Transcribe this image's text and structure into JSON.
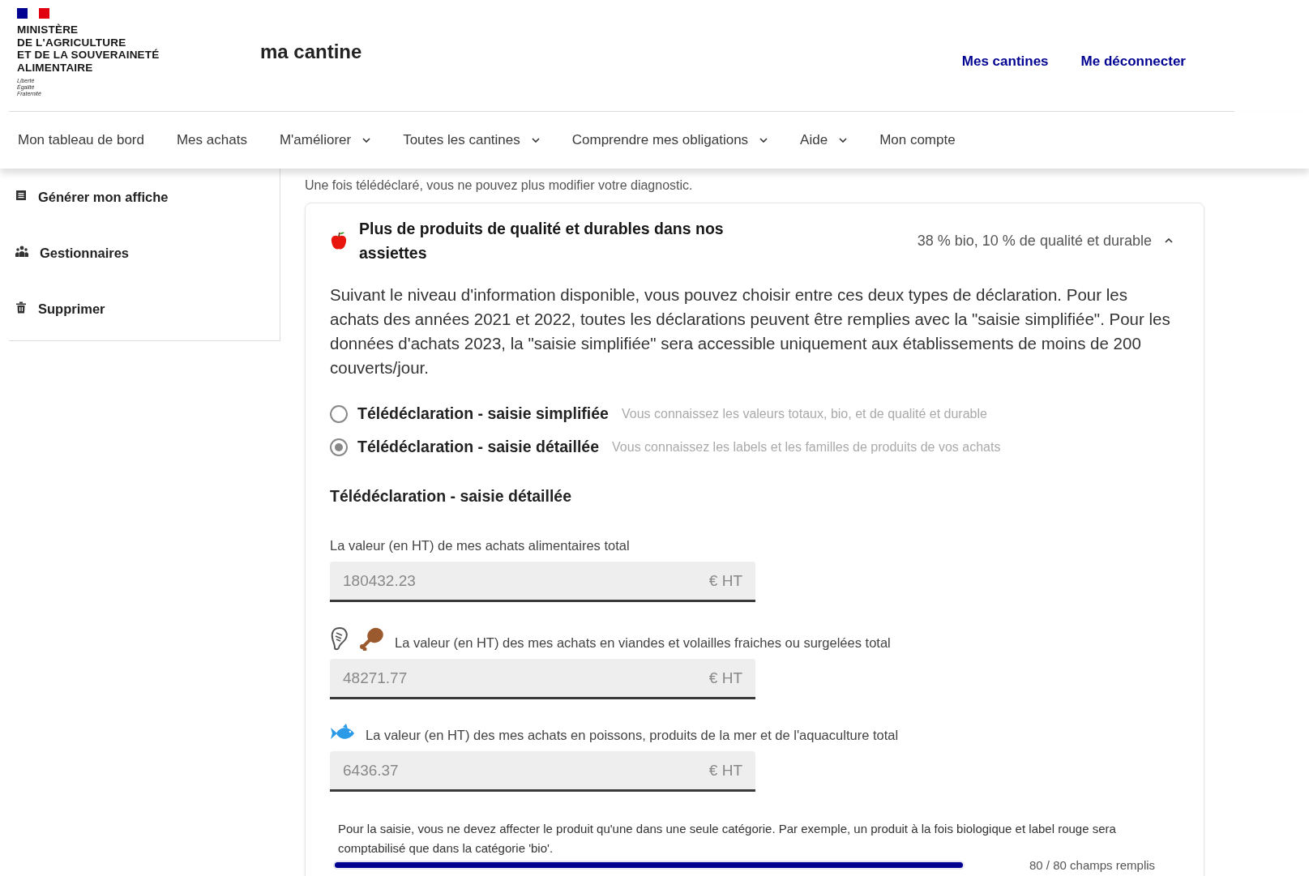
{
  "header": {
    "ministry": [
      "MINISTÈRE",
      "DE L'AGRICULTURE",
      "ET DE LA SOUVERAINETÉ",
      "ALIMENTAIRE"
    ],
    "motto": [
      "Liberté",
      "Égalité",
      "Fraternité"
    ],
    "site_name": "ma cantine",
    "links": [
      "Mes cantines",
      "Me déconnecter"
    ]
  },
  "nav": [
    {
      "label": "Mon tableau de bord",
      "dropdown": false
    },
    {
      "label": "Mes achats",
      "dropdown": false
    },
    {
      "label": "M'améliorer",
      "dropdown": true
    },
    {
      "label": "Toutes les cantines",
      "dropdown": true
    },
    {
      "label": "Comprendre mes obligations",
      "dropdown": true
    },
    {
      "label": "Aide",
      "dropdown": true
    },
    {
      "label": "Mon compte",
      "dropdown": false
    }
  ],
  "sidebar": {
    "items": [
      {
        "label": "Générer mon affiche",
        "kind": "poster"
      },
      {
        "label": "Gestionnaires",
        "kind": "people"
      },
      {
        "label": "Supprimer",
        "kind": "trash"
      }
    ]
  },
  "notice": "Une fois télédéclaré, vous ne pouvez plus modifier votre diagnostic.",
  "panel": {
    "title": "Plus de produits de qualité et durables dans nos assiettes",
    "summary": "38 % bio, 10 % de qualité et durable",
    "expanded": true,
    "intro": "Suivant le niveau d'information disponible, vous pouvez choisir entre ces deux types de déclaration. Pour les achats des années 2021 et 2022, toutes les déclarations peuvent être remplies avec la \"saisie simplifiée\". Pour les données d'achats 2023, la \"saisie simplifiée\" sera accessible uniquement aux établissements de moins de 200 couverts/jour.",
    "options": [
      {
        "label": "Télédéclaration - saisie simplifiée",
        "hint": "Vous connaissez les valeurs totaux, bio, et de qualité et durable",
        "selected": false
      },
      {
        "label": "Télédéclaration - saisie détaillée",
        "hint": "Vous connaissez les labels et les familles de produits de vos achats",
        "selected": true
      }
    ],
    "section_title": "Télédéclaration - saisie détaillée",
    "fields": [
      {
        "label": "La valeur (en HT) de mes achats alimentaires total",
        "kind": "total",
        "value": "180432.23",
        "unit": "€ HT"
      },
      {
        "label": "La valeur (en HT) des mes achats en viandes et volailles fraiches ou surgelées total",
        "kind": "meat",
        "value": "48271.77",
        "unit": "€ HT"
      },
      {
        "label": "La valeur (en HT) des mes achats en poissons, produits de la mer et de l'aquaculture total",
        "kind": "fish",
        "value": "6436.37",
        "unit": "€ HT"
      }
    ],
    "footnote": "Pour la saisie, vous ne devez affecter le produit qu'une dans une seule catégorie. Par exemple, un produit à la fois biologique et label rouge sera comptabilisé que dans la catégorie 'bio'.",
    "progress": {
      "level": 1,
      "reading": "80 / 80 champs remplis"
    }
  }
}
